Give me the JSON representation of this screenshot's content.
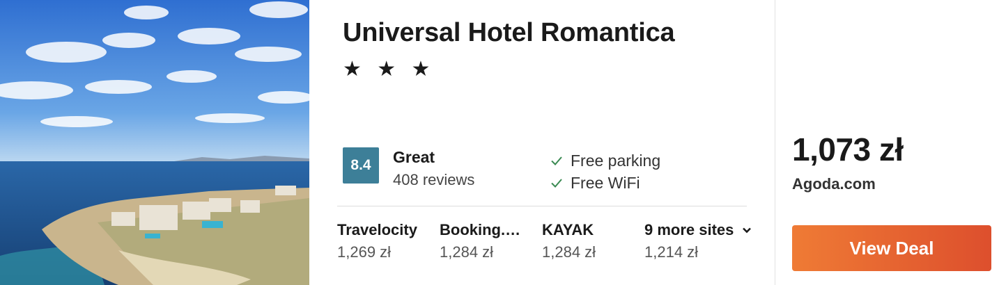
{
  "hotel": {
    "name": "Universal Hotel Romantica",
    "stars": "★ ★ ★",
    "star_count": 3
  },
  "rating": {
    "score": "8.4",
    "label": "Great",
    "reviews": "408 reviews"
  },
  "amenities": [
    "Free parking",
    "Free WiFi"
  ],
  "sites": [
    {
      "name": "Travelocity",
      "price": "1,269 zł"
    },
    {
      "name": "Booking.com",
      "price": "1,284 zł"
    },
    {
      "name": "KAYAK",
      "price": "1,284 zł"
    },
    {
      "name": "9 more sites",
      "price": "1,214 zł"
    }
  ],
  "offer": {
    "price": "1,073 zł",
    "provider": "Agoda.com",
    "button_label": "View Deal"
  },
  "colors": {
    "score_badge": "#3d7f98",
    "check": "#3a8a52",
    "button_start": "#ef7b35",
    "button_end": "#dd4f2d"
  },
  "icons": [
    "check-icon",
    "chevron-down-icon"
  ]
}
